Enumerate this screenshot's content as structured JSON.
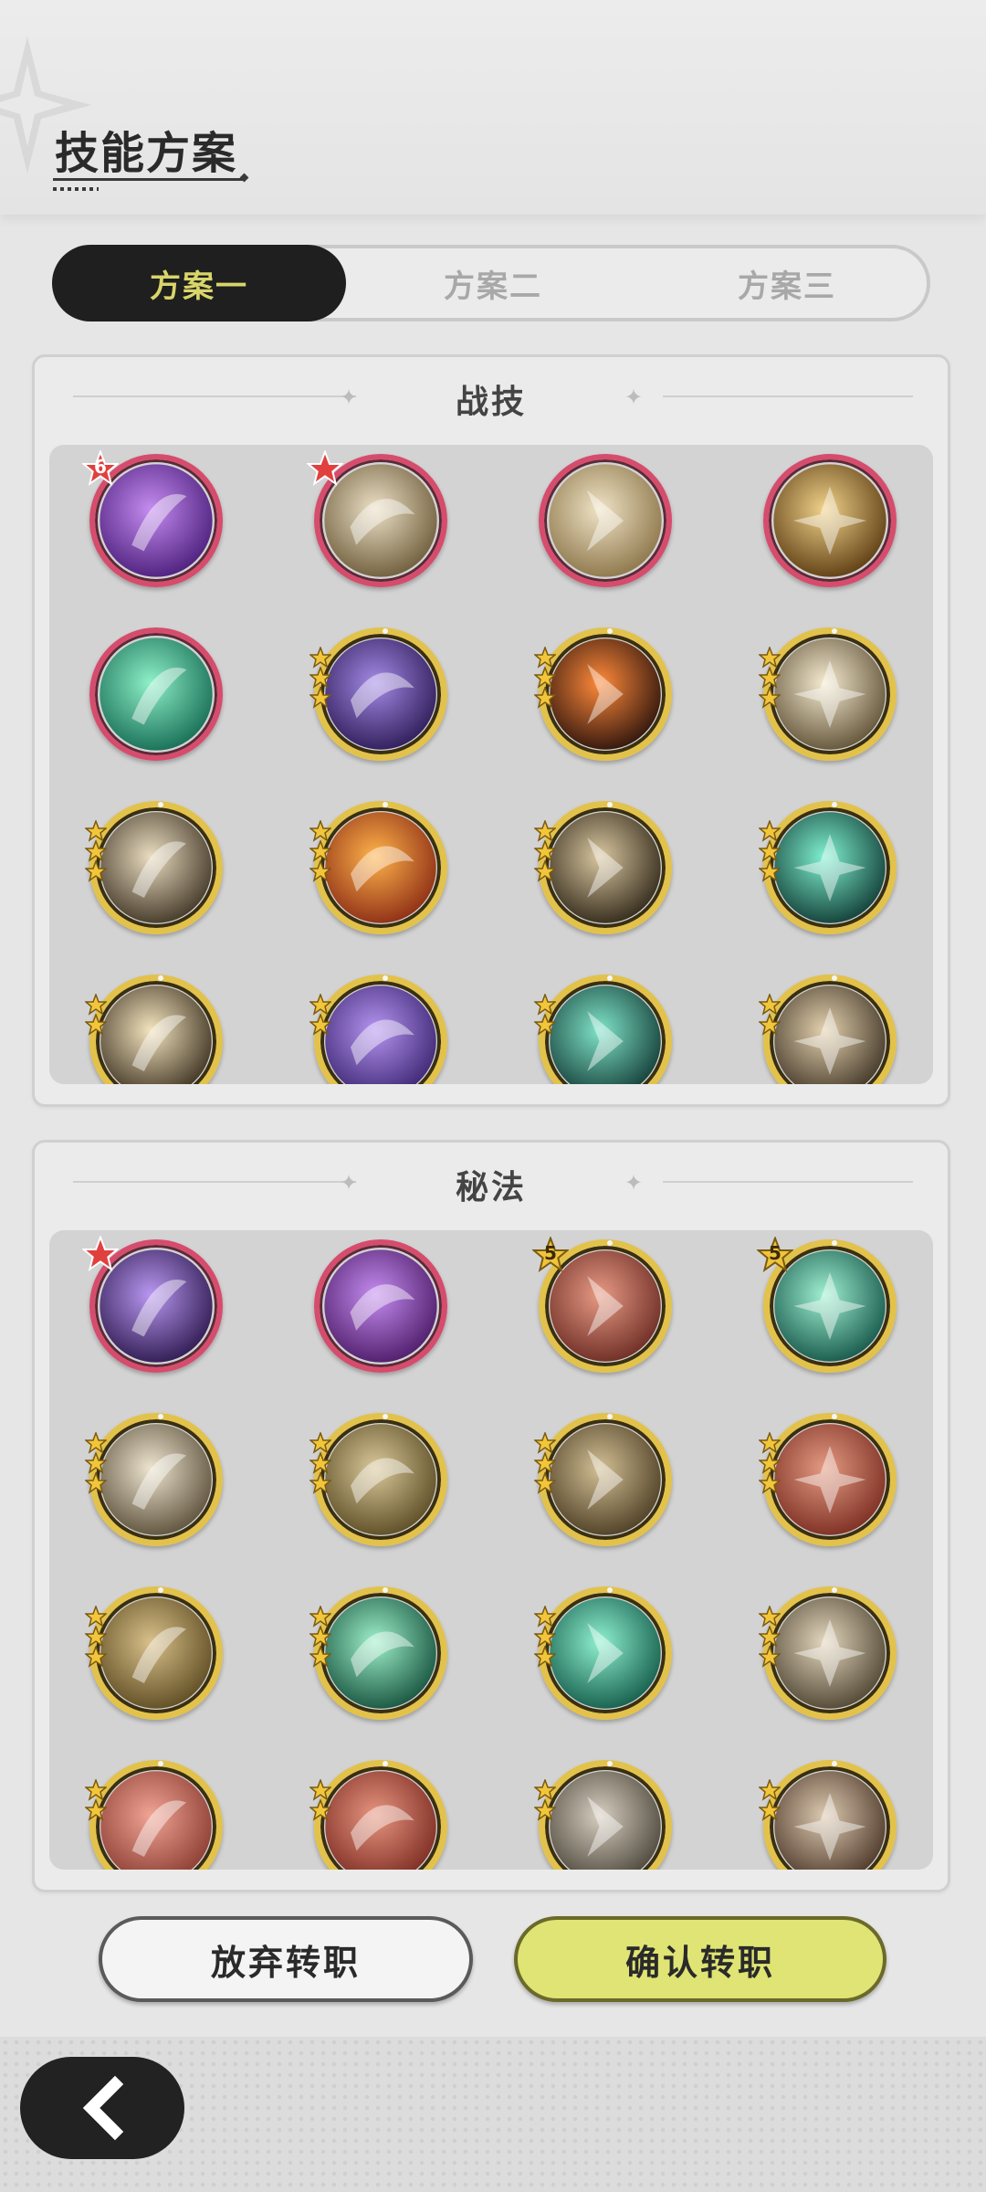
{
  "page_title": "技能方案",
  "tabs": [
    "方案一",
    "方案二",
    "方案三"
  ],
  "active_tab": 0,
  "sections": {
    "combat": {
      "title": "战技"
    },
    "arcane": {
      "title": "秘法"
    }
  },
  "combat_skills": [
    {
      "name": "purple-heart-skill-icon",
      "frame": "red",
      "badge": "6",
      "stars": 0,
      "c1": "#c48cf0",
      "c2": "#4a1d7a"
    },
    {
      "name": "grasping-hand-skill-icon",
      "frame": "red",
      "badge": "",
      "stars": 0,
      "c1": "#ece0c6",
      "c2": "#6b5a38"
    },
    {
      "name": "wind-slash-skill-icon",
      "frame": "red",
      "badge": "",
      "stars": 0,
      "c1": "#efe3c5",
      "c2": "#8a7347"
    },
    {
      "name": "golden-whirl-skill-icon",
      "frame": "red",
      "badge": "",
      "stars": 0,
      "c1": "#f0d28a",
      "c2": "#5a3a10"
    },
    {
      "name": "green-ascend-skill-icon",
      "frame": "red",
      "badge": "",
      "stars": 0,
      "c1": "#8ef0c8",
      "c2": "#146a52"
    },
    {
      "name": "shadow-claw-skill-icon",
      "frame": "gold",
      "badge": "",
      "stars": 3,
      "c1": "#a48ae6",
      "c2": "#2c1a55"
    },
    {
      "name": "fire-slash-skill-icon",
      "frame": "gold",
      "badge": "",
      "stars": 3,
      "c1": "#ff8a3a",
      "c2": "#2a120c"
    },
    {
      "name": "light-strike-skill-icon",
      "frame": "gold",
      "badge": "",
      "stars": 3,
      "c1": "#f5ead0",
      "c2": "#5e5035"
    },
    {
      "name": "cross-slash-skill-icon",
      "frame": "gold",
      "badge": "",
      "stars": 3,
      "c1": "#e9dcc0",
      "c2": "#3f3424"
    },
    {
      "name": "flame-sigil-skill-icon",
      "frame": "gold",
      "badge": "",
      "stars": 3,
      "c1": "#ffb34a",
      "c2": "#8a2a14"
    },
    {
      "name": "crescent-blade-skill-icon",
      "frame": "gold",
      "badge": "",
      "stars": 3,
      "c1": "#d8c6a0",
      "c2": "#2f2617"
    },
    {
      "name": "jade-sword-skill-icon",
      "frame": "gold",
      "badge": "",
      "stars": 3,
      "c1": "#7ff0d0",
      "c2": "#0f3a33"
    },
    {
      "name": "burst-skill-icon",
      "frame": "gold",
      "badge": "",
      "stars": 2,
      "c1": "#f3e3bd",
      "c2": "#3a2f1f"
    },
    {
      "name": "violet-wave-skill-icon",
      "frame": "gold",
      "badge": "",
      "stars": 2,
      "c1": "#b594f0",
      "c2": "#3a2470"
    },
    {
      "name": "teal-dash-skill-icon",
      "frame": "gold",
      "badge": "",
      "stars": 2,
      "c1": "#7fe3c8",
      "c2": "#123a34"
    },
    {
      "name": "spike-skill-icon",
      "frame": "gold",
      "badge": "",
      "stars": 2,
      "c1": "#e3d0ae",
      "c2": "#3e3324"
    }
  ],
  "arcane_skills": [
    {
      "name": "soul-aura-skill-icon",
      "frame": "red",
      "badge": "",
      "stars": 0,
      "c1": "#b897f0",
      "c2": "#2c184d"
    },
    {
      "name": "violet-flame-skill-icon",
      "frame": "red",
      "badge": "",
      "stars": 0,
      "c1": "#c48cf0",
      "c2": "#4b1a66"
    },
    {
      "name": "rage-fist-skill-icon",
      "frame": "gold",
      "badge": "5",
      "stars": 0,
      "c1": "#e79a84",
      "c2": "#6a2a22"
    },
    {
      "name": "heal-totem-skill-icon",
      "frame": "gold",
      "badge": "5",
      "stars": 0,
      "c1": "#9ff0d2",
      "c2": "#135446"
    },
    {
      "name": "leaf-skill-icon",
      "frame": "gold",
      "badge": "",
      "stars": 3,
      "c1": "#ede4cf",
      "c2": "#5a4e38"
    },
    {
      "name": "golem-skill-icon",
      "frame": "gold",
      "badge": "",
      "stars": 3,
      "c1": "#d9c89a",
      "c2": "#5a4a22"
    },
    {
      "name": "beast-skill-icon",
      "frame": "gold",
      "badge": "",
      "stars": 3,
      "c1": "#d2bf95",
      "c2": "#4b3c22"
    },
    {
      "name": "crack-skill-icon",
      "frame": "gold",
      "badge": "",
      "stars": 3,
      "c1": "#e39a82",
      "c2": "#7a2c20"
    },
    {
      "name": "armor-skill-icon",
      "frame": "gold",
      "badge": "",
      "stars": 3,
      "c1": "#d8c08a",
      "c2": "#5c4a20"
    },
    {
      "name": "heart-heal-skill-icon",
      "frame": "gold",
      "badge": "",
      "stars": 3,
      "c1": "#9ef0c9",
      "c2": "#14503c"
    },
    {
      "name": "emerald-blade-skill-icon",
      "frame": "gold",
      "badge": "",
      "stars": 3,
      "c1": "#8ff0cf",
      "c2": "#125a48"
    },
    {
      "name": "shield-heal-skill-icon",
      "frame": "gold",
      "badge": "",
      "stars": 3,
      "c1": "#e3d6bd",
      "c2": "#4d4330"
    },
    {
      "name": "flame-sword-skill-icon",
      "frame": "gold",
      "badge": "",
      "stars": 2,
      "c1": "#f0a494",
      "c2": "#8a3a30"
    },
    {
      "name": "crimson-guard-skill-icon",
      "frame": "gold",
      "badge": "",
      "stars": 2,
      "c1": "#e79580",
      "c2": "#7a2a20"
    },
    {
      "name": "stone-sword-skill-icon",
      "frame": "gold",
      "badge": "",
      "stars": 2,
      "c1": "#d6cec0",
      "c2": "#4a4438"
    },
    {
      "name": "heart-shield-skill-icon",
      "frame": "gold",
      "badge": "",
      "stars": 2,
      "c1": "#dcc9b0",
      "c2": "#4a3526"
    }
  ],
  "buttons": {
    "cancel": "放弃转职",
    "confirm": "确认转职"
  },
  "colors": {
    "tab_active_bg": "#1f1f1f",
    "tab_active_text": "#d9d56a",
    "confirm_bg": "#dfe474",
    "red_frame": "#d64c6d",
    "gold_frame": "#e2c24a"
  }
}
